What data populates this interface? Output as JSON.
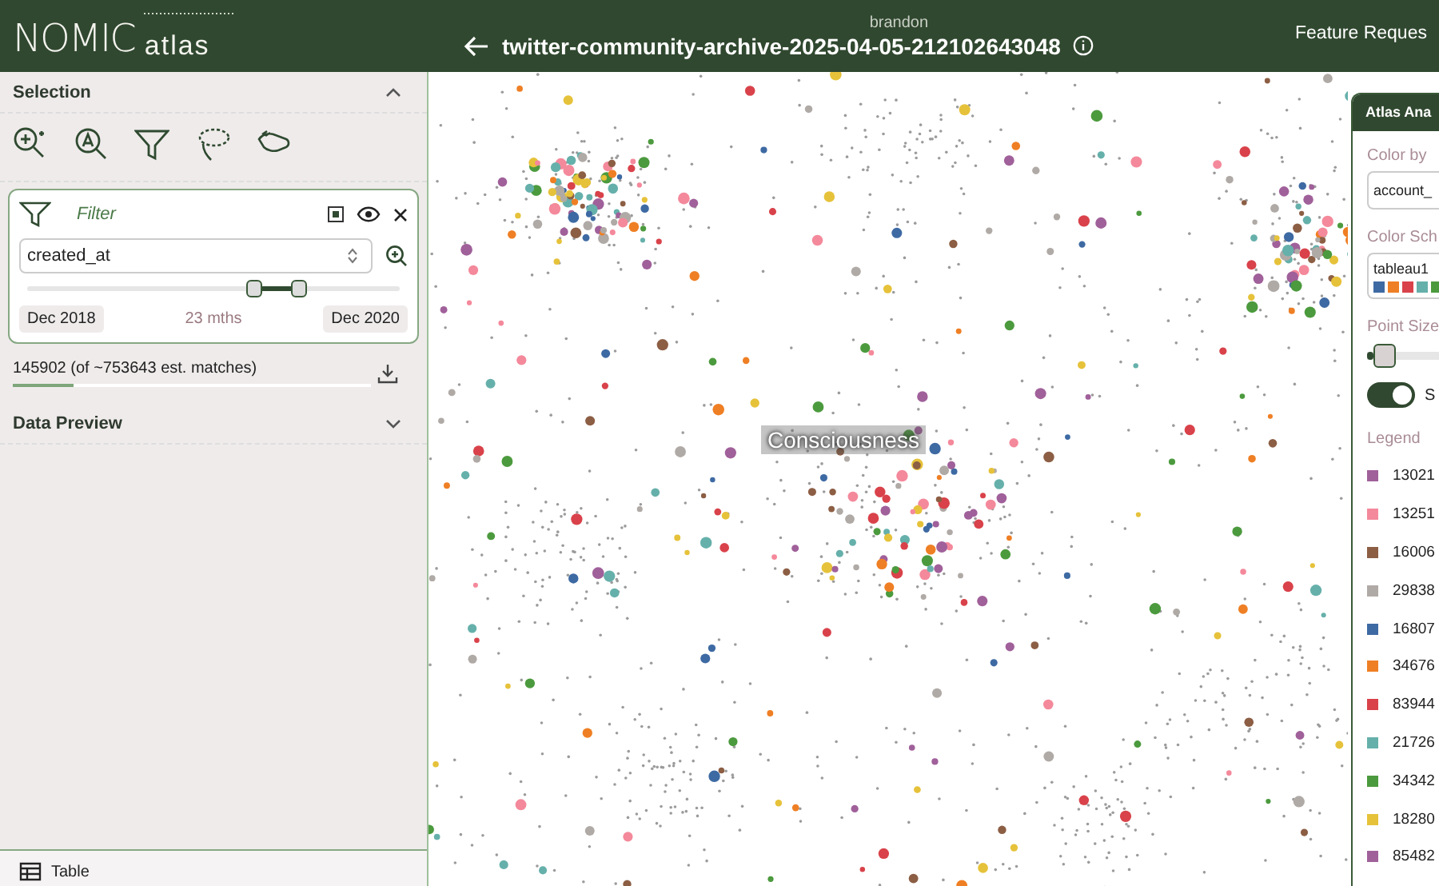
{
  "header": {
    "logo_word": "NOMIC",
    "logo_sub": "atlas",
    "owner": "brandon",
    "title": "twitter-community-archive-2025-04-05-212102643048",
    "right_link": "Feature Reques"
  },
  "sidebar": {
    "selection": {
      "title": "Selection",
      "expanded": true
    },
    "filter": {
      "title": "Filter",
      "field": "created_at",
      "handles": [
        {
          "level": 0.61
        },
        {
          "level": 0.73
        }
      ],
      "start": "Dec 2018",
      "span": "23 mths",
      "end": "Dec 2020"
    },
    "matches": {
      "text": "145902 (of ~753643 est. matches)",
      "level": 0.17
    },
    "data_preview": {
      "title": "Data Preview",
      "expanded": false
    },
    "bottom_tab": "Table"
  },
  "map": {
    "cluster_label": "Consciousness"
  },
  "analysis_panel": {
    "title": "Atlas Ana",
    "color_by_label": "Color by",
    "color_by_value": "account_",
    "scheme_label": "Color Sch",
    "scheme_value": "tableau1",
    "point_size_label": "Point Size",
    "point_size": {
      "level": 0.08
    },
    "toggle": {
      "on": true,
      "label": "S"
    },
    "legend_title": "Legend",
    "legend": [
      {
        "label": "13021",
        "color": "#a0609a"
      },
      {
        "label": "13251",
        "color": "#f4899b"
      },
      {
        "label": "16006",
        "color": "#8c5e44"
      },
      {
        "label": "29838",
        "color": "#b0aaa6"
      },
      {
        "label": "16807",
        "color": "#3e6aa3"
      },
      {
        "label": "34676",
        "color": "#ef7f24"
      },
      {
        "label": "83944",
        "color": "#d9424a"
      },
      {
        "label": "21726",
        "color": "#66b0ab"
      },
      {
        "label": "34342",
        "color": "#4c9a3e"
      },
      {
        "label": "18280",
        "color": "#e6c23a"
      },
      {
        "label": "85482",
        "color": "#a0609a"
      }
    ]
  }
}
